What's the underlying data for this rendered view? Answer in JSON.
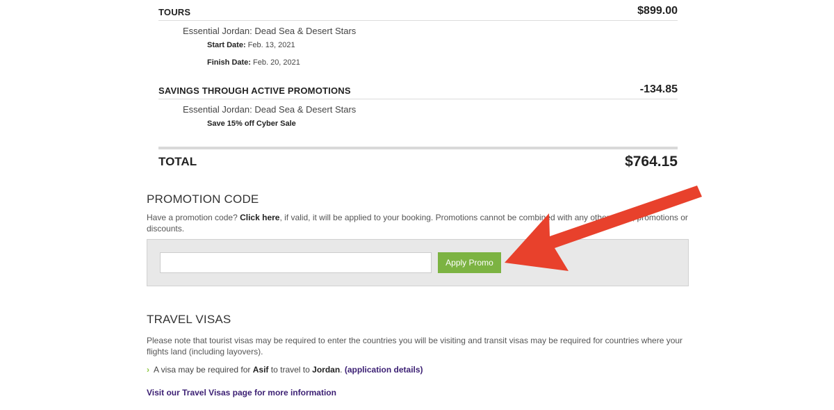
{
  "tours": {
    "label": "TOURS",
    "amount": "$899.00",
    "tour_name": "Essential Jordan: Dead Sea & Desert Stars",
    "start_label": "Start Date:",
    "start_value": " Feb. 13, 2021",
    "finish_label": "Finish Date:",
    "finish_value": " Feb. 20, 2021"
  },
  "savings": {
    "label": "SAVINGS THROUGH ACTIVE PROMOTIONS",
    "amount": "-134.85",
    "tour_name": "Essential Jordan: Dead Sea & Desert Stars",
    "promo_desc": "Save 15% off Cyber Sale"
  },
  "total": {
    "label": "TOTAL",
    "amount": "$764.15"
  },
  "promotion": {
    "title": "PROMOTION CODE",
    "text_before": "Have a promotion code? ",
    "click_here": "Click here",
    "text_after": ", if valid, it will be applied to your booking. Promotions cannot be combined with any other offers, promotions or discounts.",
    "input_value": "",
    "apply_label": "Apply Promo",
    "button_color": "#7cb342",
    "arrow_color": "#e8412c"
  },
  "visas": {
    "title": "TRAVEL VISAS",
    "note": "Please note that tourist visas may be required to enter the countries you will be visiting and transit visas may be required for countries where your flights land (including layovers).",
    "item_prefix": "A visa may be required for ",
    "traveler": "Asif",
    "item_mid": " to travel to ",
    "country": "Jordan",
    "item_dot": ". ",
    "details_link": "(application details)",
    "more_link": "Visit our Travel Visas page for more information"
  }
}
